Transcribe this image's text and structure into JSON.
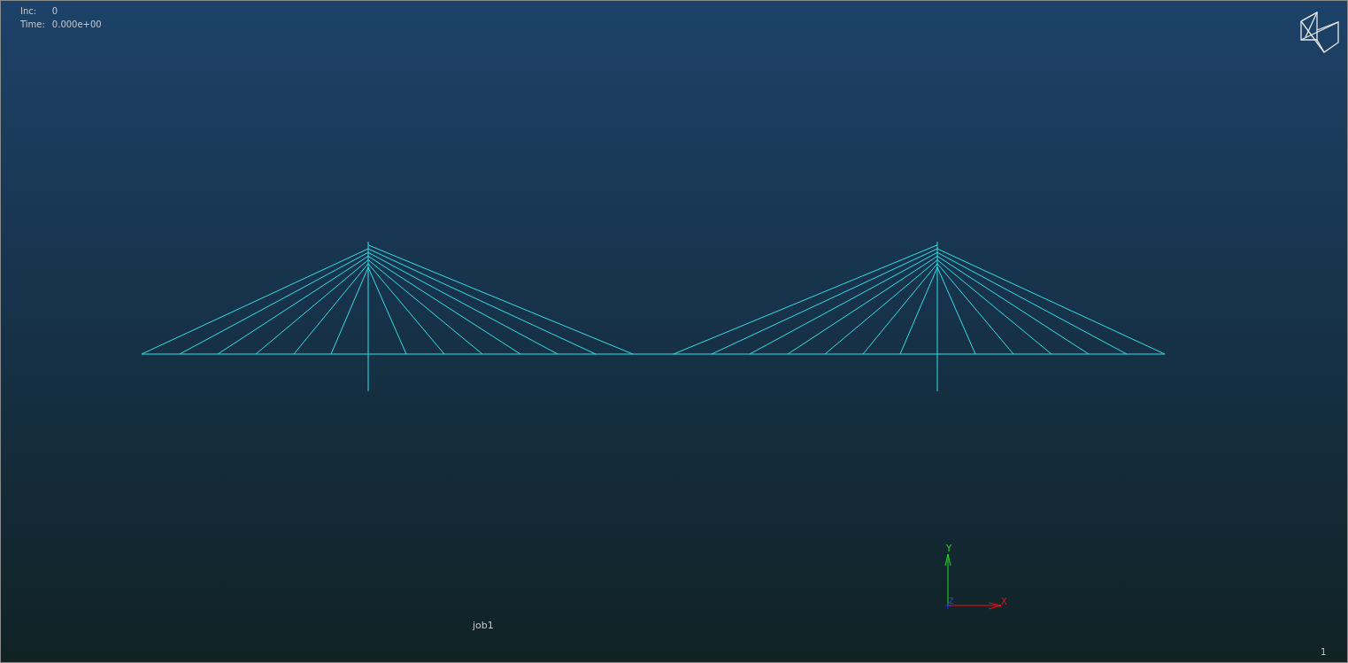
{
  "viewport": {
    "increment_label": "Inc:",
    "increment": "0",
    "time_label": "Time:",
    "time": "0.000e+00",
    "job_name": "job1",
    "page_number": "1"
  },
  "axis_triad": {
    "y_label": "Y",
    "x_label": "X",
    "z_label": "Z"
  }
}
